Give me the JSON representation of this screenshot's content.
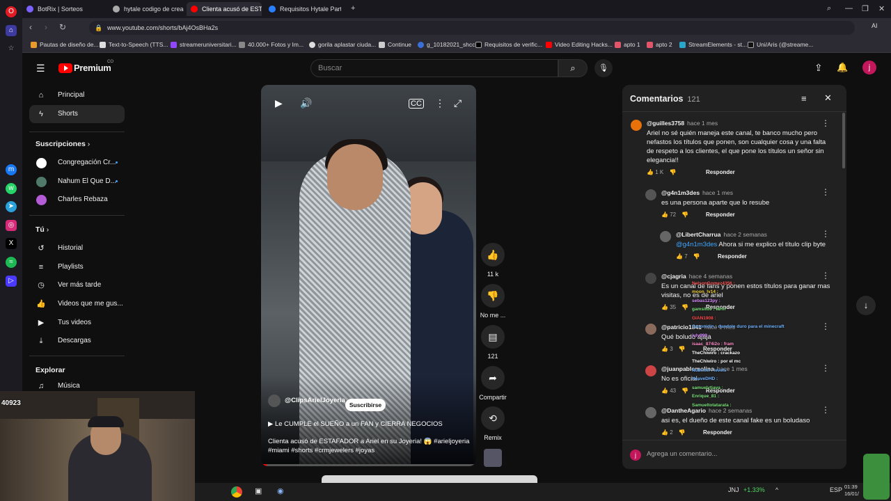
{
  "browser": {
    "tabs": [
      {
        "label": "BotRix | Sorteos",
        "color": "#7b61ff"
      },
      {
        "label": "hytale codigo de creador",
        "color": "#aaaaaa"
      },
      {
        "label": "Clienta acusó de ESTAFAD",
        "color": "#ff0000"
      },
      {
        "label": "Requisitos Hytale Partner",
        "color": "#2a7fff"
      }
    ],
    "url": "www.youtube.com/shorts/bAj4OsBHa2s",
    "bookmarks": [
      "Pautas de diseño de...",
      "Text-to-Speech (TTS...",
      "streameruniversitari...",
      "40.000+ Fotos y Im...",
      "gorila aplastar ciuda...",
      "Continue",
      "g_10182021_shcc",
      "Requisitos de verific...",
      "Video Editing Hacks...",
      "apto 1",
      "apto 2",
      "StreamElements - st...",
      "Uni/Aris (@streame..."
    ]
  },
  "youtube": {
    "logo": "Premium",
    "logo_badge": "CO",
    "search_placeholder": "Buscar",
    "avatar_letter": "j",
    "nav": [
      "Principal",
      "Shorts"
    ],
    "subs_header": "Suscripciones",
    "subscriptions": [
      {
        "name": "Congregación Cr...",
        "color": "#ffffff"
      },
      {
        "name": "Nahum El Que D...",
        "color": "#4f7a6a"
      },
      {
        "name": "Charles Rebaza",
        "color": "#b45cd6"
      }
    ],
    "you_header": "Tú",
    "you_items": [
      "Historial",
      "Playlists",
      "Ver más tarde",
      "Videos que me gus...",
      "Tus videos",
      "Descargas"
    ],
    "explore_header": "Explorar",
    "explore_items": [
      "Música"
    ]
  },
  "video": {
    "channel": "@ClipsArielJoyeria",
    "subscribe": "Suscribirse",
    "playlist": "Le CUMPLE el SUEÑO a un FAN y CIERRA NEGOCIOS",
    "title_line1": "Clienta acusó de ESTAFADOR a Ariel en su Joyeria! 😱 #arieljoyeria",
    "title_line2": "#miami #shorts #crmjewelers #joyas",
    "likes": "11 k",
    "dislike": "No me ...",
    "comments": "121",
    "share": "Compartir",
    "remix": "Remix"
  },
  "comments": {
    "title": "Comentarios",
    "count": "121",
    "add_placeholder": "Agrega un comentario...",
    "items": [
      {
        "author": "@guilles3758",
        "time": "hace 1 mes",
        "text": "Ariel no sé quién maneja este canal, te banco mucho pero nefastos los títulos que ponen, son cualquier cosa y una falta de respeto a los clientes, el que pone los títulos un señor sin elegancia!!",
        "likes": "1 K",
        "reply": "Responder",
        "color": "#e8710a"
      },
      {
        "author": "@g4n1m3des",
        "time": "hace 1 mes",
        "text": "es una persona aparte que lo resube",
        "likes": "72",
        "reply": "Responder",
        "color": "#555555"
      },
      {
        "author": "@LibertCharrua",
        "time": "hace 2 semanas",
        "mention": "@g4n1m3des",
        "text": "Ahora si me explico el título clip byte",
        "likes": "7",
        "reply": "Responder",
        "color": "#666666"
      },
      {
        "author": "@cjagria",
        "time": "hace 4 semanas",
        "text": "Es un canal de fans y ponen estos títulos para ganar mas visitas, no es de ariel",
        "likes": "35",
        "reply": "Responder",
        "color": "#444444"
      },
      {
        "author": "@patricio1841",
        "time": "hace 1 mes",
        "text": "Qué boludo ajaja",
        "likes": "3",
        "reply": "Responder",
        "color": "#8a6a5a"
      },
      {
        "author": "@juanpablomolina",
        "time": "hace 1 mes",
        "text": "No es oficial.",
        "likes": "43",
        "reply": "Responder",
        "color": "#c44"
      },
      {
        "author": "@DantheAgario",
        "time": "hace 2 semanas",
        "text": "asi es, el dueño de este canal fake es un boludaso",
        "likes": "2",
        "reply": "Responder",
        "color": "#666666"
      }
    ]
  },
  "chat": [
    "NelsonGomez4356 :",
    "moon_lv14 :",
    "sebas123py :",
    "gamsitos : farm",
    "GIAN1908 :",
    "Ossonidin : dandole duro para el minecraft",
    "july999 :",
    "isaac_874i2o : fram",
    "TheChiwiro : crackazo",
    "TheChiwiro : por el mc",
    "Nubixtel : levels",
    "NeaveDHD :",
    "samuelytjava :",
    "Enrique_81 :",
    "Samueltotatarata :"
  ],
  "webcam": {
    "counter": "40923"
  },
  "taskbar": {
    "ticker": "JNJ",
    "change": "+1.33%",
    "lang": "ESP",
    "time": "01:39",
    "date": "16/01/"
  }
}
